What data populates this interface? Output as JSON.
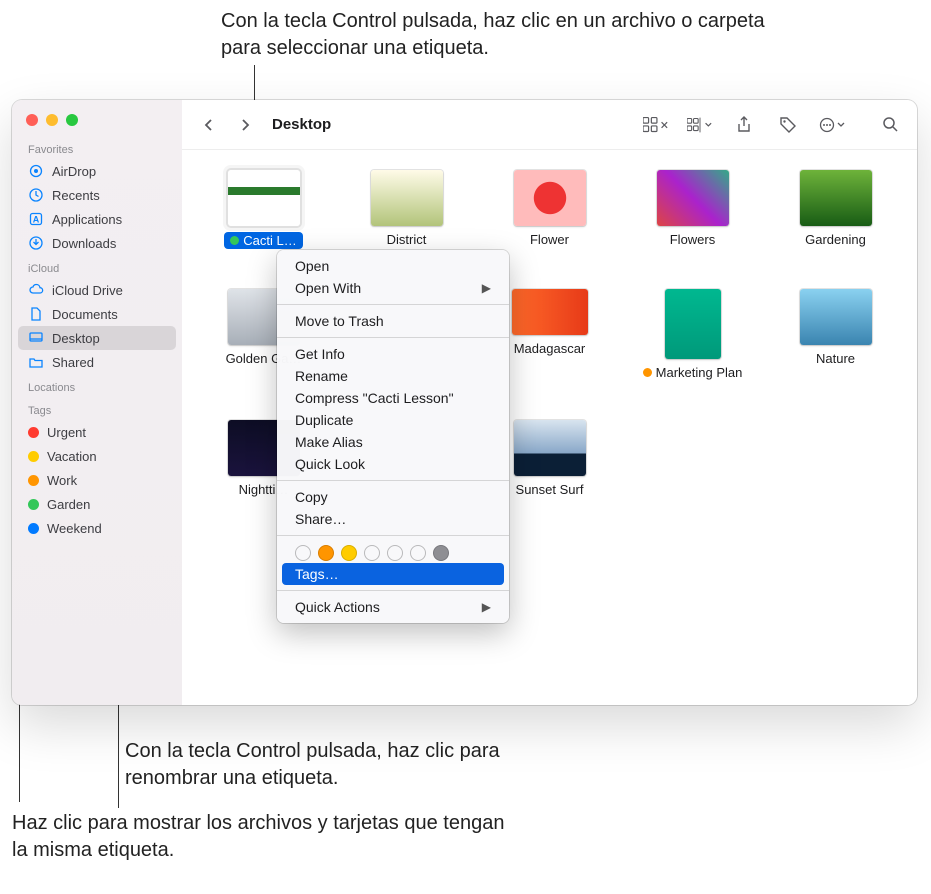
{
  "callouts": {
    "top": "Con la tecla Control pulsada, haz clic en un archivo o carpeta para seleccionar una etiqueta.",
    "mid": "Con la tecla Control pulsada, haz clic para renombrar una etiqueta.",
    "bottom": "Haz clic para mostrar los archivos y tarjetas que tengan la misma etiqueta."
  },
  "toolbar": {
    "title": "Desktop"
  },
  "sidebar": {
    "sections": {
      "favorites": "Favorites",
      "icloud": "iCloud",
      "locations": "Locations",
      "tags": "Tags"
    },
    "favorites": [
      {
        "id": "airdrop",
        "label": "AirDrop"
      },
      {
        "id": "recents",
        "label": "Recents"
      },
      {
        "id": "applications",
        "label": "Applications"
      },
      {
        "id": "downloads",
        "label": "Downloads"
      }
    ],
    "icloud": [
      {
        "id": "iclouddrive",
        "label": "iCloud Drive"
      },
      {
        "id": "documents",
        "label": "Documents"
      },
      {
        "id": "desktop",
        "label": "Desktop",
        "active": true
      },
      {
        "id": "shared",
        "label": "Shared"
      }
    ],
    "tags": [
      {
        "id": "urgent",
        "label": "Urgent",
        "color": "#ff3b30"
      },
      {
        "id": "vacation",
        "label": "Vacation",
        "color": "#ffcc00"
      },
      {
        "id": "work",
        "label": "Work",
        "color": "#ff9500"
      },
      {
        "id": "garden",
        "label": "Garden",
        "color": "#34c759"
      },
      {
        "id": "weekend",
        "label": "Weekend",
        "color": "#007aff"
      }
    ]
  },
  "files": [
    {
      "id": "cacti",
      "label": "Cacti L…",
      "tag": "#34c759",
      "selected": true,
      "thumb": "th-cacti"
    },
    {
      "id": "district",
      "label": "District",
      "thumb": "th-district"
    },
    {
      "id": "flower",
      "label": "Flower",
      "thumb": "th-flower"
    },
    {
      "id": "flowers",
      "label": "Flowers",
      "thumb": "th-flowers"
    },
    {
      "id": "gardening",
      "label": "Gardening",
      "thumb": "th-garden"
    },
    {
      "id": "golden",
      "label": "Golden Ga…",
      "thumb": "th-golden"
    },
    {
      "id": "hidden1",
      "label": "",
      "thumb": ""
    },
    {
      "id": "madagascar",
      "label": "Madagascar",
      "thumb": "th-madagascar"
    },
    {
      "id": "marketing",
      "label": "Marketing Plan",
      "tag": "#ff9500",
      "thumb": "th-marketing"
    },
    {
      "id": "nature",
      "label": "Nature",
      "thumb": "th-nature"
    },
    {
      "id": "night",
      "label": "Nightti…",
      "thumb": "th-night"
    },
    {
      "id": "hidden2",
      "label": "",
      "thumb": ""
    },
    {
      "id": "sunset",
      "label": "Sunset Surf",
      "thumb": "th-sunset"
    }
  ],
  "contextMenu": {
    "open": "Open",
    "openWith": "Open With",
    "moveToTrash": "Move to Trash",
    "getInfo": "Get Info",
    "rename": "Rename",
    "compress": "Compress \"Cacti Lesson\"",
    "duplicate": "Duplicate",
    "makeAlias": "Make Alias",
    "quickLook": "Quick Look",
    "copy": "Copy",
    "share": "Share…",
    "tagsLabel": "Tags…",
    "quickActions": "Quick Actions",
    "tagColors": [
      "none",
      "#ff9500",
      "#ffcc00",
      "none",
      "none",
      "none",
      "#8e8e93"
    ]
  }
}
